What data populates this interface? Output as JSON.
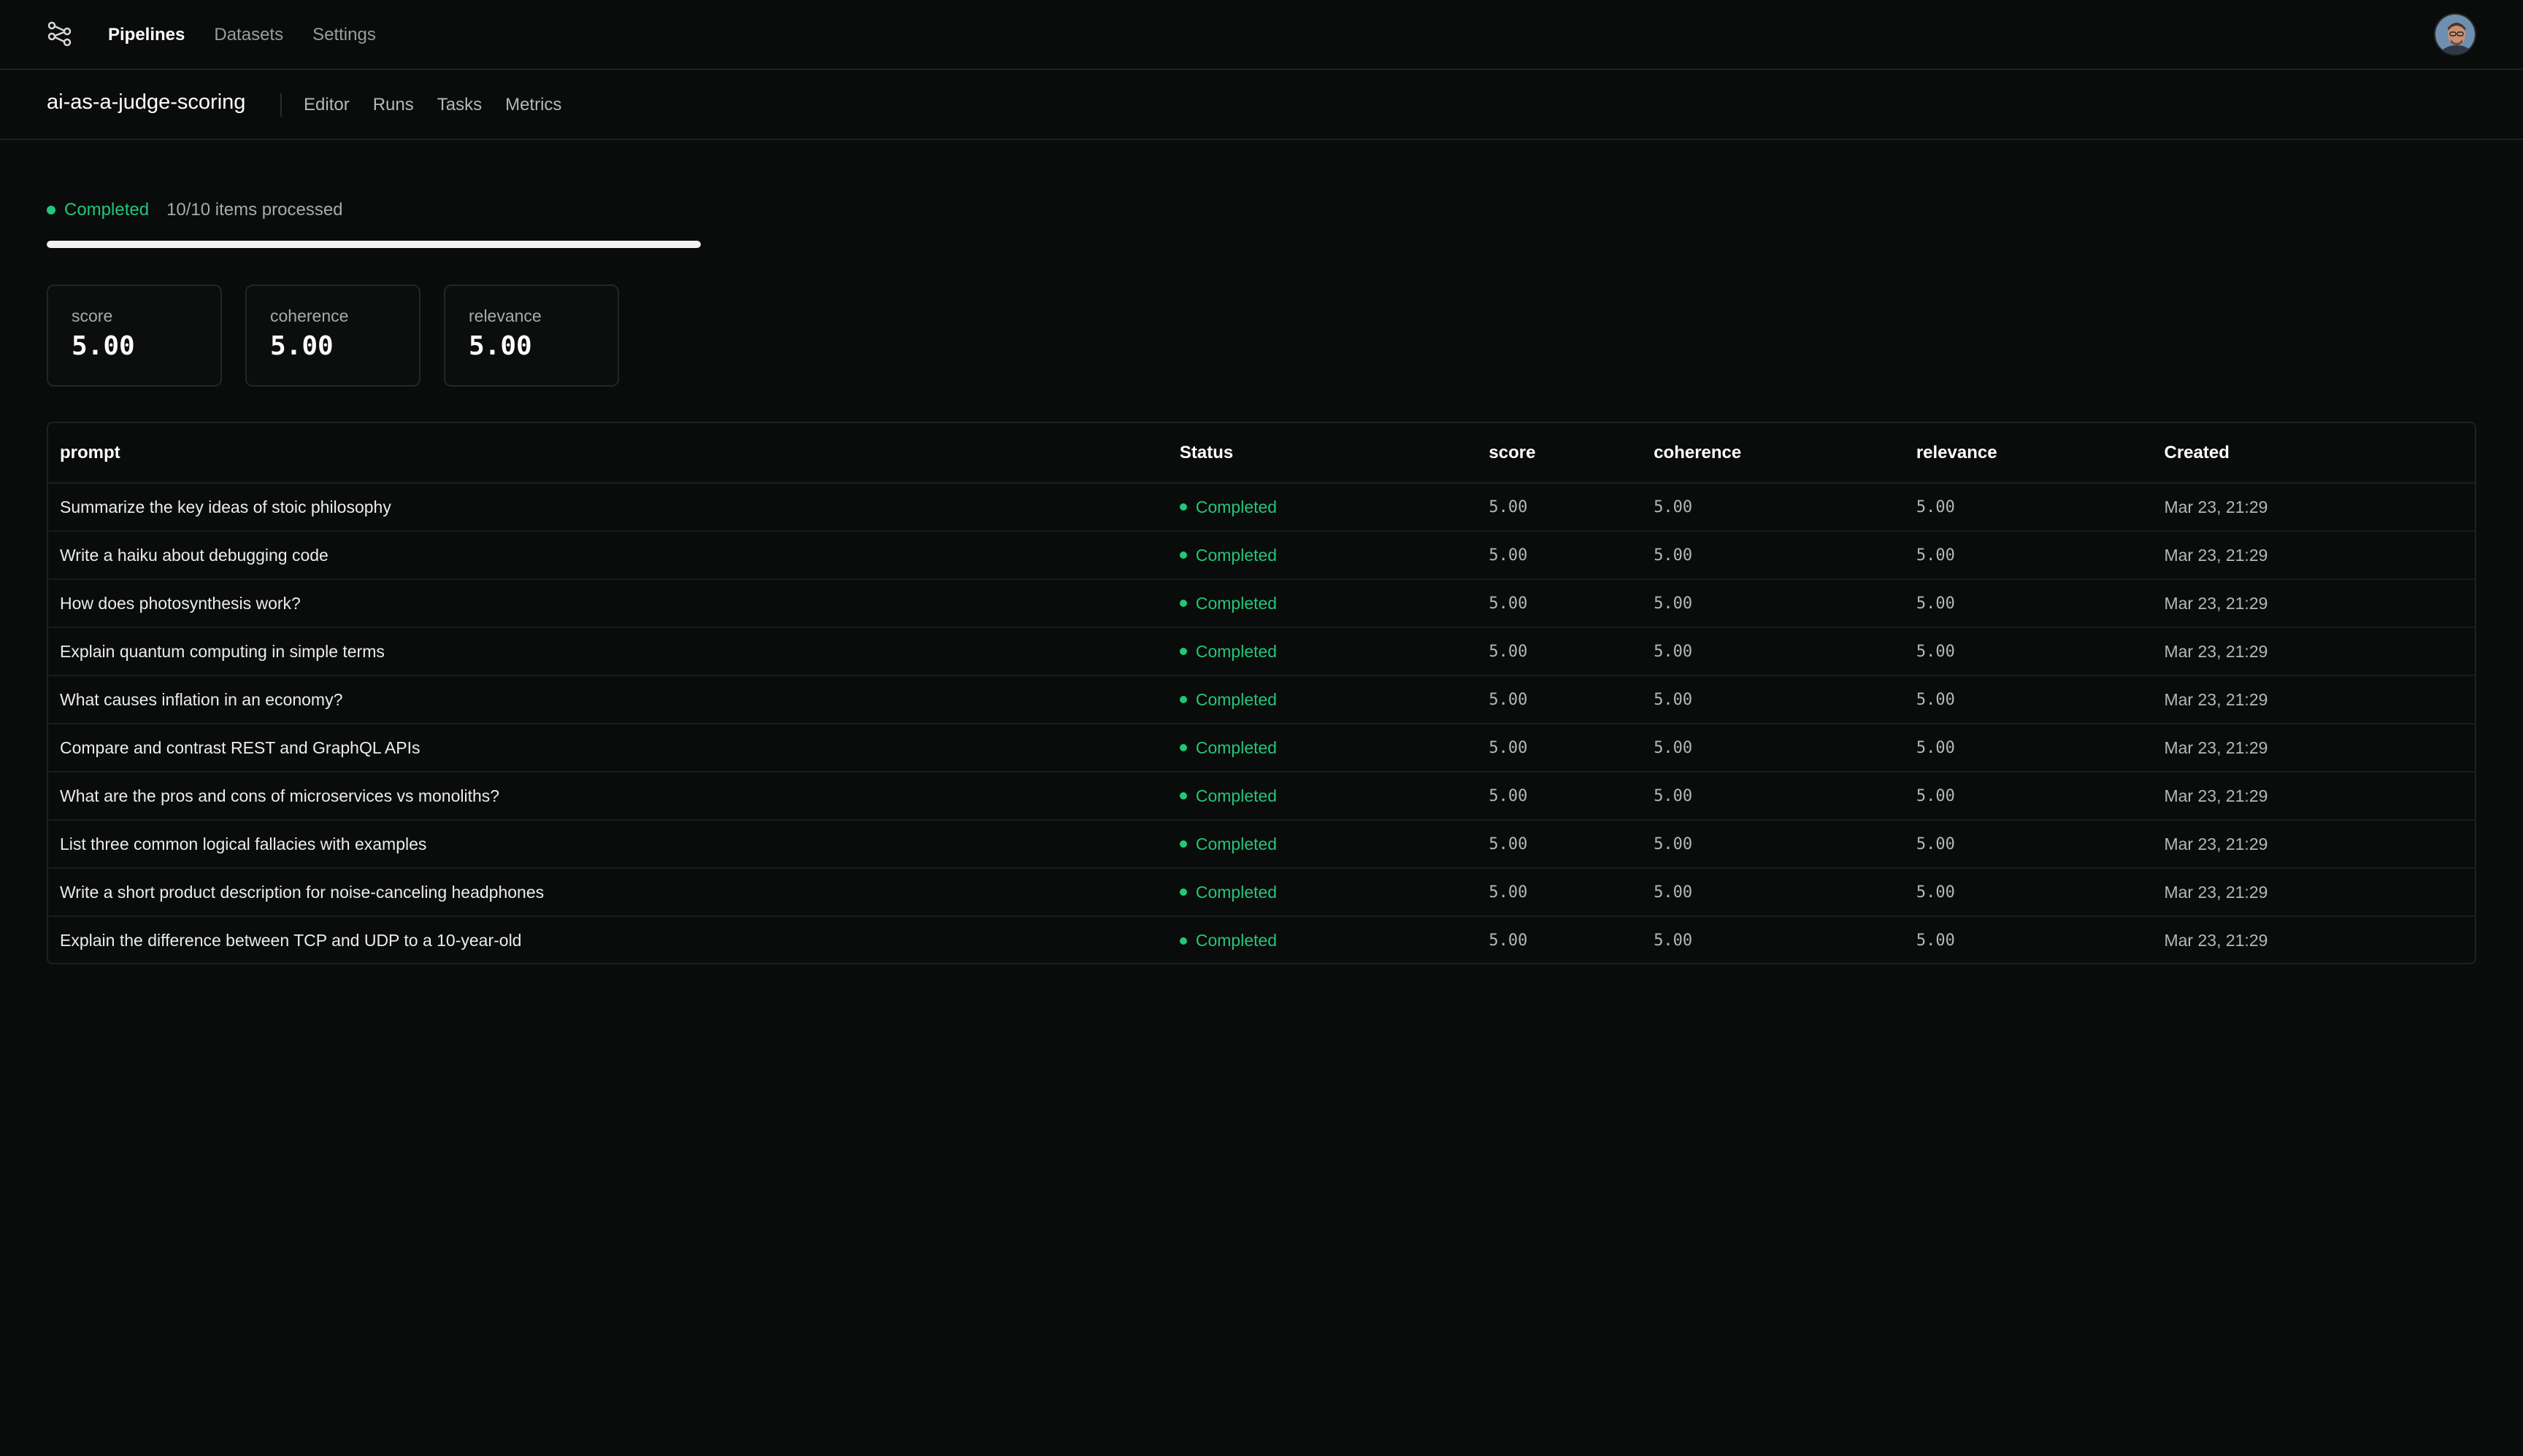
{
  "nav": {
    "logo_icon": "pipeline-graph-icon",
    "links": [
      {
        "label": "Pipelines",
        "active": true
      },
      {
        "label": "Datasets",
        "active": false
      },
      {
        "label": "Settings",
        "active": false
      }
    ]
  },
  "pipeline": {
    "title": "ai-as-a-judge-scoring",
    "tabs": [
      "Editor",
      "Runs",
      "Tasks",
      "Metrics"
    ]
  },
  "run": {
    "status": "Completed",
    "processed": "10/10 items processed",
    "progress_fraction": 1.0
  },
  "metrics": [
    {
      "label": "score",
      "value": "5.00"
    },
    {
      "label": "coherence",
      "value": "5.00"
    },
    {
      "label": "relevance",
      "value": "5.00"
    }
  ],
  "table": {
    "columns": [
      "prompt",
      "Status",
      "score",
      "coherence",
      "relevance",
      "Created"
    ],
    "rows": [
      {
        "prompt": "Summarize the key ideas of stoic philosophy",
        "status": "Completed",
        "score": "5.00",
        "coherence": "5.00",
        "relevance": "5.00",
        "created": "Mar 23, 21:29"
      },
      {
        "prompt": "Write a haiku about debugging code",
        "status": "Completed",
        "score": "5.00",
        "coherence": "5.00",
        "relevance": "5.00",
        "created": "Mar 23, 21:29"
      },
      {
        "prompt": "How does photosynthesis work?",
        "status": "Completed",
        "score": "5.00",
        "coherence": "5.00",
        "relevance": "5.00",
        "created": "Mar 23, 21:29"
      },
      {
        "prompt": "Explain quantum computing in simple terms",
        "status": "Completed",
        "score": "5.00",
        "coherence": "5.00",
        "relevance": "5.00",
        "created": "Mar 23, 21:29"
      },
      {
        "prompt": "What causes inflation in an economy?",
        "status": "Completed",
        "score": "5.00",
        "coherence": "5.00",
        "relevance": "5.00",
        "created": "Mar 23, 21:29"
      },
      {
        "prompt": "Compare and contrast REST and GraphQL APIs",
        "status": "Completed",
        "score": "5.00",
        "coherence": "5.00",
        "relevance": "5.00",
        "created": "Mar 23, 21:29"
      },
      {
        "prompt": "What are the pros and cons of microservices vs monoliths?",
        "status": "Completed",
        "score": "5.00",
        "coherence": "5.00",
        "relevance": "5.00",
        "created": "Mar 23, 21:29"
      },
      {
        "prompt": "List three common logical fallacies with examples",
        "status": "Completed",
        "score": "5.00",
        "coherence": "5.00",
        "relevance": "5.00",
        "created": "Mar 23, 21:29"
      },
      {
        "prompt": "Write a short product description for noise-canceling headphones",
        "status": "Completed",
        "score": "5.00",
        "coherence": "5.00",
        "relevance": "5.00",
        "created": "Mar 23, 21:29"
      },
      {
        "prompt": "Explain the difference between TCP and UDP to a 10-year-old",
        "status": "Completed",
        "score": "5.00",
        "coherence": "5.00",
        "relevance": "5.00",
        "created": "Mar 23, 21:29"
      }
    ]
  },
  "colors": {
    "background": "#0a0b0b",
    "accent_green": "#21c77a",
    "border": "#1f2121"
  }
}
